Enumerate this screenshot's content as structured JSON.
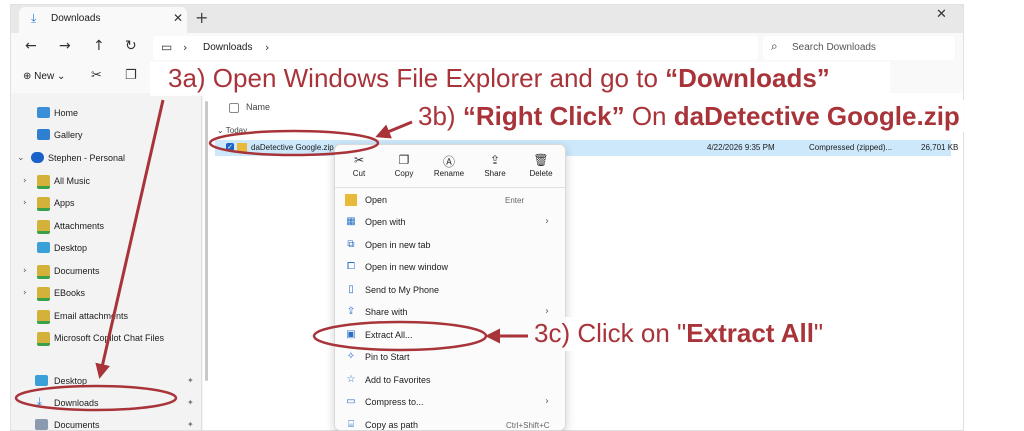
{
  "window": {
    "tab_title": "Downloads",
    "tab_icon": "download-icon",
    "new_tab": "+",
    "close": "✕"
  },
  "nav": {
    "back": "←",
    "forward": "→",
    "up": "↑",
    "refresh": "↻",
    "breadcrumb": "Downloads",
    "search_placeholder": "Search Downloads"
  },
  "commands": {
    "new_label": "New"
  },
  "sidebar": {
    "items": [
      {
        "label": "Home",
        "icon": "home-icon"
      },
      {
        "label": "Gallery",
        "icon": "gallery-icon"
      },
      {
        "label": "Stephen - Personal",
        "icon": "onedrive-icon"
      },
      {
        "label": "All Music",
        "icon": "folder-icon"
      },
      {
        "label": "Apps",
        "icon": "folder-icon"
      },
      {
        "label": "Attachments",
        "icon": "folder-icon"
      },
      {
        "label": "Desktop",
        "icon": "desktop-icon"
      },
      {
        "label": "Documents",
        "icon": "folder-icon"
      },
      {
        "label": "EBooks",
        "icon": "folder-icon"
      },
      {
        "label": "Email attachments",
        "icon": "folder-icon"
      },
      {
        "label": "Microsoft Copilot Chat Files",
        "icon": "folder-icon"
      }
    ],
    "pinned": [
      {
        "label": "Desktop",
        "icon": "desktop-icon"
      },
      {
        "label": "Downloads",
        "icon": "download-icon"
      },
      {
        "label": "Documents",
        "icon": "documents-icon"
      }
    ]
  },
  "file_list": {
    "column_name": "Name",
    "group": "Today",
    "rows": [
      {
        "name": "daDetective Google.zip",
        "date": "4/22/2026 9:35 PM",
        "type": "Compressed (zipped)...",
        "size": "26,701 KB"
      }
    ]
  },
  "context_menu": {
    "quick_actions": [
      {
        "label": "Cut",
        "icon": "cut-icon"
      },
      {
        "label": "Copy",
        "icon": "copy-icon"
      },
      {
        "label": "Rename",
        "icon": "rename-icon"
      },
      {
        "label": "Share",
        "icon": "share-icon"
      },
      {
        "label": "Delete",
        "icon": "delete-icon"
      }
    ],
    "items": [
      {
        "label": "Open",
        "shortcut": "Enter",
        "icon": "open-icon"
      },
      {
        "label": "Open with",
        "icon": "open-with-icon",
        "submenu": true
      },
      {
        "label": "Open in new tab",
        "icon": "new-tab-icon"
      },
      {
        "label": "Open in new window",
        "icon": "new-window-icon"
      },
      {
        "label": "Send to My Phone",
        "icon": "phone-icon"
      },
      {
        "label": "Share with",
        "icon": "share-with-icon",
        "submenu": true
      },
      {
        "label": "Extract All...",
        "icon": "extract-icon"
      },
      {
        "label": "Pin to Start",
        "icon": "pin-icon"
      },
      {
        "label": "Add to Favorites",
        "icon": "star-icon"
      },
      {
        "label": "Compress to...",
        "icon": "compress-icon",
        "submenu": true
      },
      {
        "label": "Copy as path",
        "shortcut": "Ctrl+Shift+C",
        "icon": "copy-path-icon"
      }
    ]
  },
  "annotations": {
    "step_a_prefix": "3a) Open Windows File Explorer and go to ",
    "step_a_bold": "“Downloads”",
    "step_b_prefix": "3b)  ",
    "step_b_bold1": "“Right Click”",
    "step_b_mid": " On ",
    "step_b_bold2": "daDetective Google.zip",
    "step_c_prefix": "3c) Click on \"",
    "step_c_bold": "Extract All",
    "step_c_suffix": "\"",
    "color": "#a8343a"
  }
}
